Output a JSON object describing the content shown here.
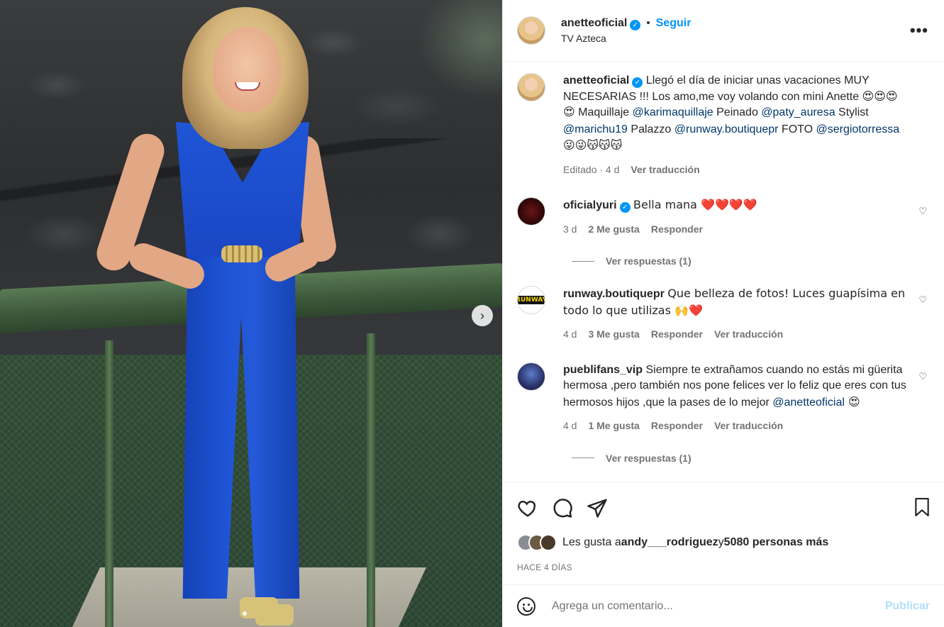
{
  "post": {
    "carousel_next": "›"
  },
  "header": {
    "username": "anetteoficial",
    "verified_mark": "✓",
    "separator": "•",
    "follow_label": "Seguir",
    "subtitle": "TV Azteca",
    "more": "•••"
  },
  "caption": {
    "username": "anetteoficial",
    "text1": "Llegó el día de iniciar unas vacaciones MUY NECESARIAS !!! Los amo,me voy volando con mini Anette 😍😍😍😍 Maquillaje ",
    "mention1": "@karimaquillaje",
    "text2": " Peinado ",
    "mention2": "@paty_auresa",
    "text3": " Stylist ",
    "mention3": "@marichu19",
    "text4": " Palazzo ",
    "mention4": "@runway.boutiquepr",
    "text5": " FOTO ",
    "mention5": "@sergiotorressa",
    "text6": " 😜😜😽😽😽",
    "edited": "Editado · 4 d",
    "translate": "Ver traducción"
  },
  "comments": [
    {
      "username": "oficialyuri",
      "text": "Bella mana ❤️❤️❤️❤️",
      "time": "3 d",
      "likes": "2 Me gusta",
      "reply": "Responder",
      "replies": "Ver respuestas (1)"
    },
    {
      "username": "runway.boutiquepr",
      "avatar_text": "RUNWAY",
      "text": "Que belleza de fotos! Luces guapísima en todo lo que utilizas 🙌❤️",
      "time": "4 d",
      "likes": "3 Me gusta",
      "reply": "Responder",
      "translate": "Ver traducción"
    },
    {
      "username": "pueblifans_vip",
      "text": "Siempre te extrañamos cuando no estás mi güerita hermosa ,pero también nos pone felices ver lo feliz que eres con tus hermosos hijos ,que la pases de lo mejor ",
      "mention": "@anetteoficial",
      "emoji": " 😍",
      "time": "4 d",
      "likes": "1 Me gusta",
      "reply": "Responder",
      "translate": "Ver traducción",
      "replies": "Ver respuestas (1)"
    }
  ],
  "heart_small": "♡",
  "likes": {
    "prefix": "Les gusta a ",
    "user": "andy___rodriguez",
    "middle": " y ",
    "count": "5080 personas más"
  },
  "posted": "HACE 4 DÍAS",
  "comment_box": {
    "placeholder": "Agrega un comentario...",
    "publish": "Publicar"
  }
}
